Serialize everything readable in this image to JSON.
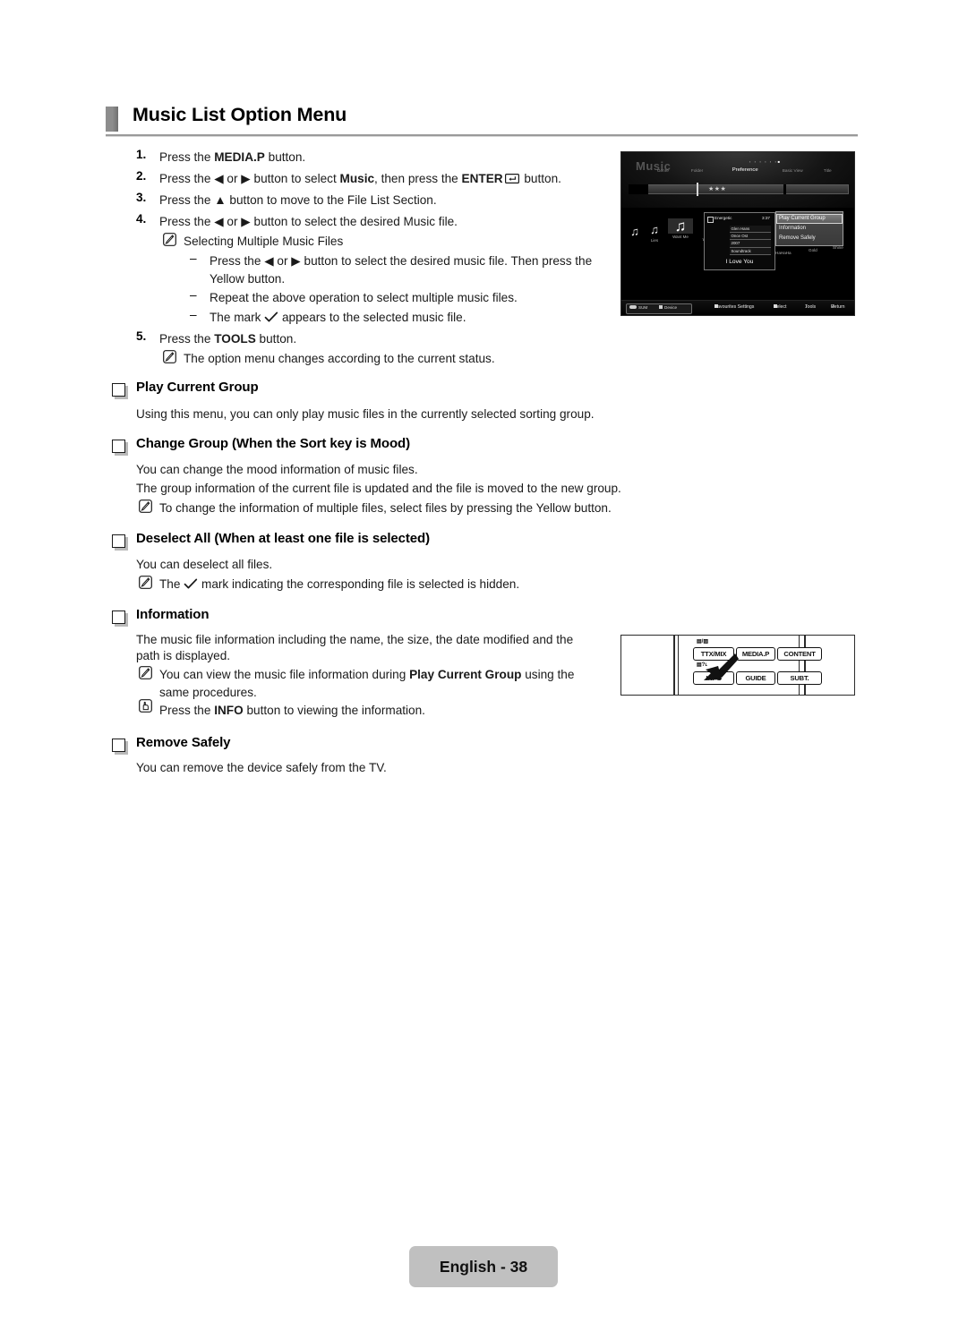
{
  "heading": "Music List Option Menu",
  "steps": [
    {
      "num": "1.",
      "parts": [
        {
          "t": "Press the ",
          "b": false
        },
        {
          "t": "MEDIA.P",
          "b": true
        },
        {
          "t": " button.",
          "b": false
        }
      ]
    },
    {
      "num": "2.",
      "parts": [
        {
          "t": "Press the ◀ or ▶ button to select ",
          "b": false
        },
        {
          "t": "Music",
          "b": true
        },
        {
          "t": ", then press the ",
          "b": false
        },
        {
          "t": "ENTER",
          "b": true
        },
        {
          "t": "ENTER_GLYPH",
          "b": false
        },
        {
          "t": " button.",
          "b": false
        }
      ]
    },
    {
      "num": "3.",
      "parts": [
        {
          "t": "Press the ▲ button to move to the File List Section.",
          "b": false
        }
      ]
    },
    {
      "num": "4.",
      "parts": [
        {
          "t": "Press the ◀ or ▶ button to select the desired Music file.",
          "b": false
        }
      ]
    },
    {
      "num": "5.",
      "parts": [
        {
          "t": "Press the ",
          "b": false
        },
        {
          "t": "TOOLS",
          "b": true
        },
        {
          "t": " button.",
          "b": false
        }
      ]
    }
  ],
  "step4_note": "Selecting Multiple Music Files",
  "step4_dashes": [
    "Press the ◀ or ▶ button to select the desired music file. Then press the",
    "Yellow button.",
    "Repeat the above operation to select multiple music files.",
    "The mark ✓ appears to the selected music file."
  ],
  "dash_lines": {
    "d1a": "Press the ◀ or ▶ button to select the desired music file. Then press the",
    "d1b": "Yellow button.",
    "d2": "Repeat the above operation to select multiple music files.",
    "d3_pre": "The mark",
    "d3_post": "appears to the selected music file."
  },
  "step5_note": "The option menu changes according to the current status.",
  "sections": [
    {
      "title": "Play Current Group",
      "body": [
        "Using this menu, you can only play music files in the currently selected sorting group."
      ]
    },
    {
      "title": "Change Group (When the Sort key is Mood)",
      "body": [
        "You can change the mood information of music files.",
        "The group information of the current file is updated and the file is moved to the new group."
      ],
      "note": "To change the information of multiple files, select files by pressing the Yellow button."
    },
    {
      "title": "Deselect All (When at least one file is selected)",
      "body": [
        "You can deselect all files."
      ],
      "note_pre": "The",
      "note_post": "mark indicating the corresponding file is selected is hidden."
    },
    {
      "title": "Information",
      "body": [
        "The music file information including the name, the size, the date modified and the",
        "path is displayed."
      ],
      "note1_a": "You can view the music file information during ",
      "note1_b": "Play Current Group",
      "note1_c": " using the",
      "note1_d": "same procedures.",
      "note2_a": "Press the ",
      "note2_b": "INFO",
      "note2_c": " button to viewing the information."
    },
    {
      "title": "Remove Safely",
      "body": [
        "You can remove the device safely from the TV."
      ]
    }
  ],
  "tv_screen": {
    "title": "Music",
    "nav": [
      {
        "label": "Genre",
        "active": false
      },
      {
        "label": "Folder",
        "active": false
      },
      {
        "label": "Preference",
        "active": true
      },
      {
        "label": "Basic View",
        "active": false
      },
      {
        "label": "Title",
        "active": false
      }
    ],
    "stars": "★★★",
    "items": [
      {
        "label": "Lies",
        "selected": false
      },
      {
        "label": "Want Me",
        "selected": false
      },
      {
        "label": "Way",
        "selected": false
      }
    ],
    "selected_item_label": "Want Me",
    "right_labels": [
      "HaHaHa",
      "Gold",
      "Shine"
    ],
    "info_box": {
      "mood": "Energetic",
      "duration": "3:37",
      "meta": [
        "Glen Hans",
        "Once Ost",
        "2007",
        "Soundtrack"
      ],
      "song": "I Love You"
    },
    "option_menu": [
      {
        "label": "Play Current Group",
        "highlighted": true
      },
      {
        "label": "Information",
        "highlighted": false
      },
      {
        "label": "Remove Safely",
        "highlighted": false
      }
    ],
    "footer": {
      "source": "SUM",
      "device": "Device",
      "hints": [
        "Favourites Settings",
        "Select",
        "Tools",
        "Return"
      ]
    }
  },
  "remote": {
    "buttons_top": [
      "TTX/MIX",
      "MEDIA.P",
      "CONTENT"
    ],
    "buttons_bottom": [
      "INFO",
      "GUIDE",
      "SUBT."
    ]
  },
  "page_label": "English - 38",
  "colors": {
    "heading_marker": "#8d8d8d",
    "rule": "#9a9a9a",
    "page_tag_bg": "#c0c0c0",
    "tv_highlight": "#7f7f7f"
  }
}
